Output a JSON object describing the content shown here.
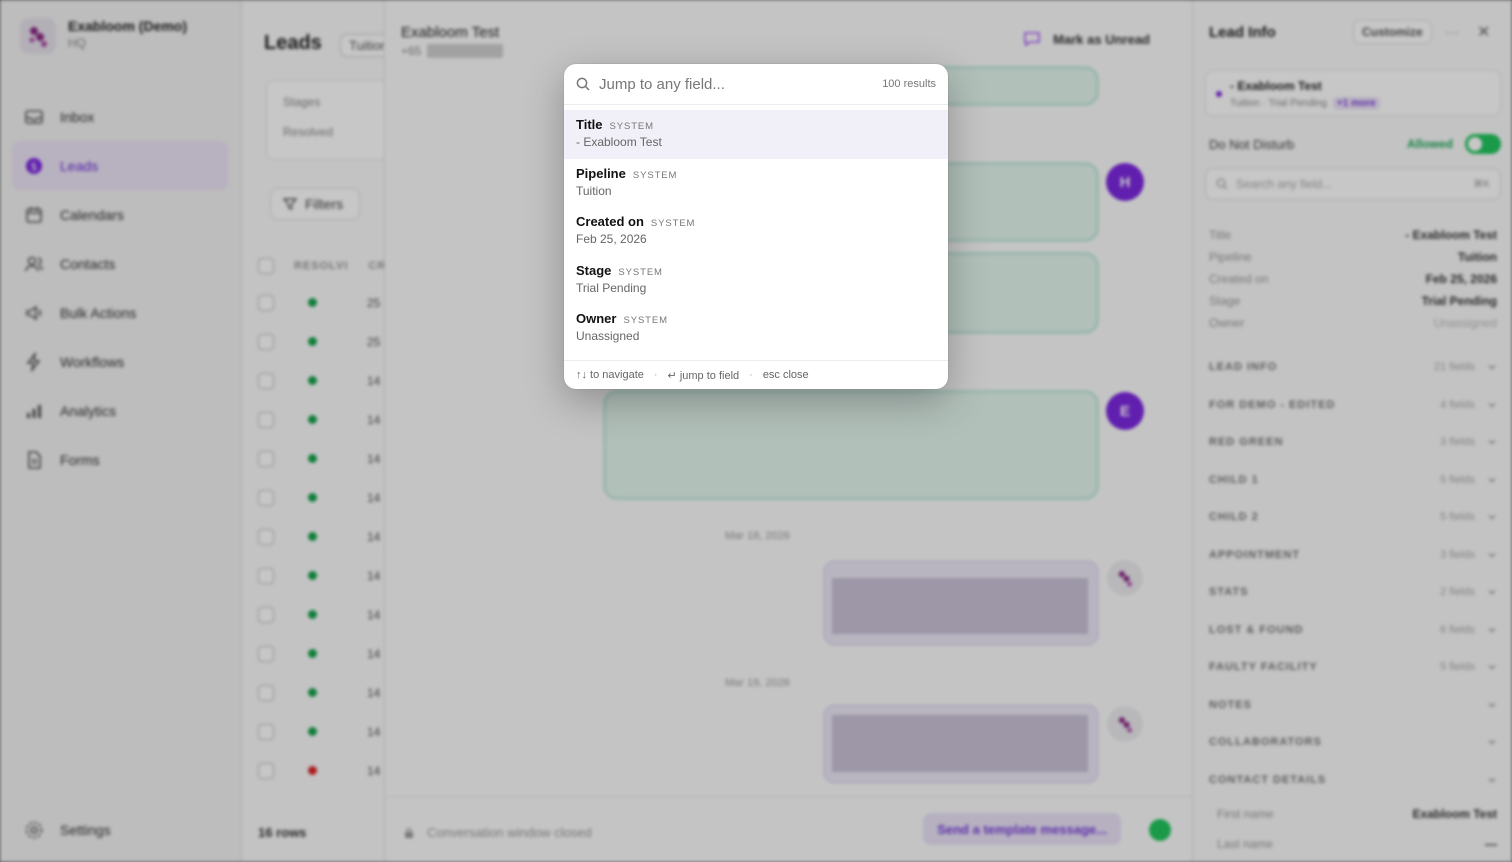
{
  "sidebar": {
    "org_name": "Exabloom (Demo)",
    "org_sub": "HQ",
    "items": [
      {
        "label": "Inbox",
        "icon": "inbox-icon"
      },
      {
        "label": "Leads",
        "icon": "dollar-icon",
        "active": true
      },
      {
        "label": "Calendars",
        "icon": "calendar-icon"
      },
      {
        "label": "Contacts",
        "icon": "contacts-icon"
      },
      {
        "label": "Bulk Actions",
        "icon": "megaphone-icon"
      },
      {
        "label": "Workflows",
        "icon": "bolt-icon"
      },
      {
        "label": "Analytics",
        "icon": "chart-icon"
      },
      {
        "label": "Forms",
        "icon": "form-icon"
      }
    ],
    "settings_label": "Settings"
  },
  "leads": {
    "title": "Leads",
    "tab": "Tuition",
    "stages_label": "Stages",
    "resolved_label": "Resolved",
    "filters_label": "Filters",
    "column_resolved": "RESOLVI",
    "column_created": "CR",
    "rows": [
      {
        "status": "green",
        "num": "25"
      },
      {
        "status": "green",
        "num": "25"
      },
      {
        "status": "green",
        "num": "14"
      },
      {
        "status": "green",
        "num": "14"
      },
      {
        "status": "green",
        "num": "14"
      },
      {
        "status": "green",
        "num": "14"
      },
      {
        "status": "green",
        "num": "14"
      },
      {
        "status": "green",
        "num": "14"
      },
      {
        "status": "green",
        "num": "14"
      },
      {
        "status": "green",
        "num": "14"
      },
      {
        "status": "green",
        "num": "14"
      },
      {
        "status": "green",
        "num": "14"
      },
      {
        "status": "red",
        "num": "14"
      }
    ],
    "rows_count": "16 rows"
  },
  "conversation": {
    "name": "Exabloom Test",
    "phone_prefix": "+65",
    "mark_unread": "Mark as Unread",
    "avatar_h": "H",
    "avatar_e": "E",
    "date_1": "Mar 18, 2026",
    "date_2": "Mar 19, 2026",
    "window_closed": "Conversation window closed",
    "template_button": "Send a template message..."
  },
  "lead_info": {
    "title": "Lead Info",
    "customize": "Customize",
    "card_title": "- Exabloom Test",
    "card_sub": "Tuition · Trial Pending",
    "card_badge": "+1 more",
    "dnd_label": "Do Not Disturb",
    "dnd_state": "Allowed",
    "search_placeholder": "Search any field...",
    "search_kbd": "⌘K",
    "fields": [
      {
        "k": "Title",
        "v": "- Exabloom Test"
      },
      {
        "k": "Pipeline",
        "v": "Tuition"
      },
      {
        "k": "Created on",
        "v": "Feb 25, 2026"
      },
      {
        "k": "Stage",
        "v": "Trial Pending"
      },
      {
        "k": "Owner",
        "v": "Unassigned",
        "muted": true
      }
    ],
    "sections": [
      {
        "name": "LEAD INFO",
        "count": "21 fields"
      },
      {
        "name": "FOR DEMO - EDITED",
        "count": "4 fields"
      },
      {
        "name": "RED GREEN",
        "count": "3 fields"
      },
      {
        "name": "CHILD 1",
        "count": "5 fields"
      },
      {
        "name": "CHILD 2",
        "count": "5 fields"
      },
      {
        "name": "APPOINTMENT",
        "count": "3 fields"
      },
      {
        "name": "STATS",
        "count": "2 fields"
      },
      {
        "name": "LOST & FOUND",
        "count": "6 fields"
      },
      {
        "name": "FAULTY FACILITY",
        "count": "5 fields"
      },
      {
        "name": "NOTES",
        "count": ""
      },
      {
        "name": "COLLABORATORS",
        "count": ""
      },
      {
        "name": "CONTACT DETAILS",
        "count": ""
      }
    ],
    "contact_fields": [
      {
        "k": "First name",
        "v": "Exabloom Test"
      },
      {
        "k": "Last name",
        "v": "—"
      }
    ]
  },
  "modal": {
    "search_placeholder": "Jump to any field...",
    "search_value": "",
    "result_count": "100 results",
    "results": [
      {
        "label": "Title",
        "tag": "SYSTEM",
        "value": "- Exabloom Test",
        "selected": true
      },
      {
        "label": "Pipeline",
        "tag": "SYSTEM",
        "value": "Tuition"
      },
      {
        "label": "Created on",
        "tag": "SYSTEM",
        "value": "Feb 25, 2026"
      },
      {
        "label": "Stage",
        "tag": "SYSTEM",
        "value": "Trial Pending"
      },
      {
        "label": "Owner",
        "tag": "SYSTEM",
        "value": "Unassigned"
      }
    ],
    "hint_navigate": "↑↓ to navigate",
    "hint_jump": "↵ jump to field",
    "hint_close": "esc close",
    "hint_sep": "·"
  },
  "colors": {
    "accent": "#7d28e0",
    "selected_row": "#f1eff8",
    "status_green": "#15a34a",
    "status_red": "#dc2626"
  }
}
